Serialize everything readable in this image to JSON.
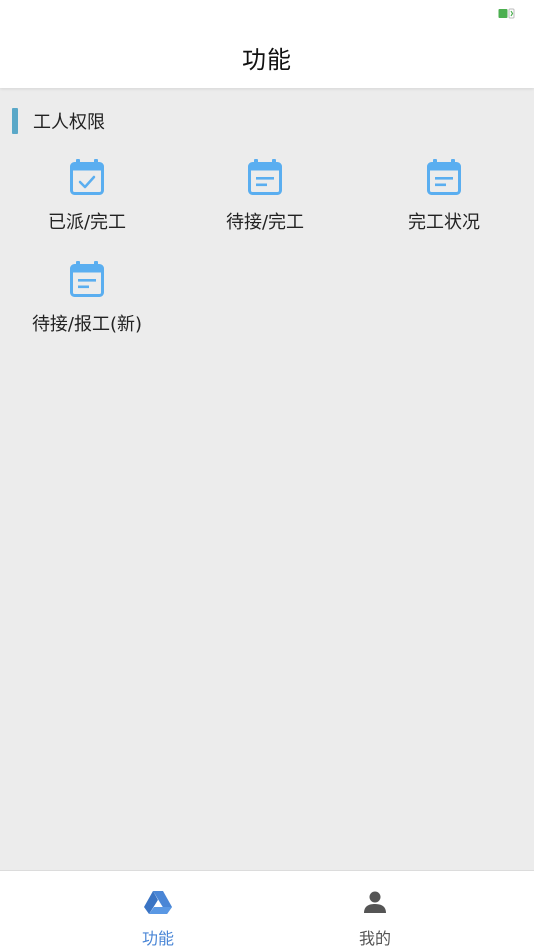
{
  "header": {
    "title": "功能"
  },
  "section": {
    "title": "工人权限"
  },
  "functions": [
    {
      "label": "已派/完工",
      "icon": "calendar-check-icon"
    },
    {
      "label": "待接/完工",
      "icon": "calendar-note-icon"
    },
    {
      "label": "完工状况",
      "icon": "calendar-note-icon"
    },
    {
      "label": "待接/报工(新)",
      "icon": "calendar-note-icon"
    }
  ],
  "bottom_nav": {
    "tabs": [
      {
        "label": "功能",
        "icon": "drive-triangle-icon",
        "active": true
      },
      {
        "label": "我的",
        "icon": "person-icon",
        "active": false
      }
    ]
  },
  "colors": {
    "accent": "#4a86d6",
    "icon_blue": "#5aaef0",
    "section_bar": "#5aa8c8",
    "background": "#ececec"
  }
}
